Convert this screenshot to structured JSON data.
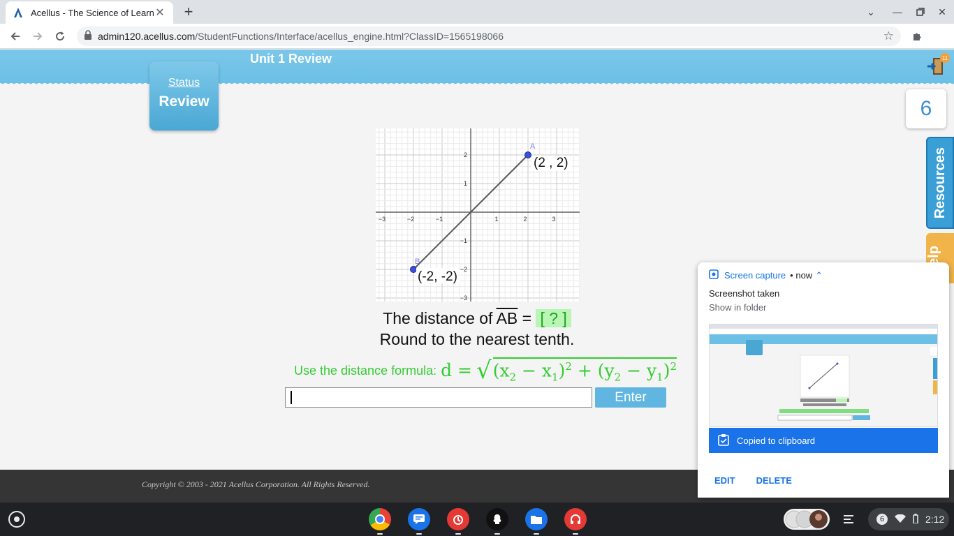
{
  "browser": {
    "tab_title": "Acellus - The Science of Learning",
    "url_host": "admin120.acellus.com",
    "url_path": "/StudentFunctions/Interface/acellus_engine.html?ClassID=1565198066"
  },
  "page": {
    "unit_title": "Unit 1 Review",
    "status_label": "Status",
    "review_label": "Review",
    "counter_value": "6",
    "door_badge": "11",
    "resources_tab": "Resources",
    "help_tab": "Help"
  },
  "problem": {
    "graph": {
      "x_ticks": [
        "−3",
        "−2",
        "−1",
        "1",
        "2",
        "3"
      ],
      "y_ticks": [
        "2",
        "1",
        "−1",
        "−2",
        "−3"
      ],
      "point_a_label": "A",
      "point_b_label": "B",
      "point_a_coords": "(2 ,  2)",
      "point_b_coords": "(-2, -2)",
      "point_a": [
        2,
        2
      ],
      "point_b": [
        -2,
        -2
      ]
    },
    "distance_prefix": "The distance of ",
    "segment": "AB",
    "distance_equals": " = ",
    "blank": "[ ? ]",
    "round_text": "Round to the nearest tenth.",
    "formula_label": "Use the distance formula:",
    "formula_lhs": "d = ",
    "answer_value": "",
    "enter_label": "Enter"
  },
  "footer": {
    "copyright": "Copyright © 2003 - 2021 Acellus Corporation.  All Rights Reserved."
  },
  "notification": {
    "app_name": "Screen capture",
    "time": "• now",
    "title": "Screenshot taken",
    "message": "Show in folder",
    "clipboard": "Copied to clipboard",
    "edit": "EDIT",
    "delete": "DELETE"
  },
  "shelf": {
    "tray_badge": "6",
    "time": "2:12"
  },
  "colors": {
    "banner": "#6cc0e6",
    "formula_green": "#32cd32",
    "chrome_blue": "#1a73e8",
    "point_blue": "#3b4fd8"
  }
}
